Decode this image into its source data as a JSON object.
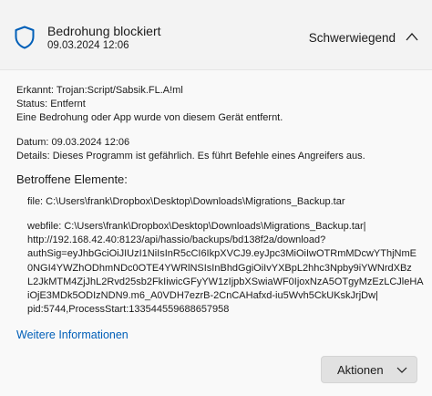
{
  "header": {
    "title": "Bedrohung blockiert",
    "timestamp": "09.03.2024 12:06",
    "severity": "Schwerwiegend",
    "icon": "shield-icon",
    "accent_color": "#005fb8"
  },
  "details": {
    "detected": "Erkannt:  Trojan:Script/Sabsik.FL.A!ml",
    "status": "Status:  Entfernt",
    "status_message": "Eine Bedrohung oder App wurde von diesem Gerät entfernt.",
    "date": "Datum:  09.03.2024 12:06",
    "description": "Details:  Dieses Programm ist gefährlich. Es führt Befehle eines Angreifers aus."
  },
  "affected": {
    "title": "Betroffene Elemente:",
    "file_line": "file: C:\\Users\\frank\\Dropbox\\Desktop\\Downloads\\Migrations_Backup.tar",
    "webfile_lines": [
      "webfile: C:\\Users\\frank\\Dropbox\\Desktop\\Downloads\\Migrations_Backup.tar|",
      "http://192.168.42.40:8123/api/hassio/backups/bd138f2a/download?",
      "authSig=eyJhbGciOiJIUzI1NiIsInR5cCI6IkpXVCJ9.eyJpc3MiOiIwOTRmMDcwYThjNmE",
      "0NGI4YWZhODhmNDc0OTE4YWRlNSIsInBhdGgiOiIvYXBpL2hhc3Npby9iYWNrdXBz",
      "L2JkMTM4ZjJhL2Rvd25sb2FkIiwicGFyYW1zIjpbXSwiaWF0IjoxNzA5OTgyMzEzLCJleHA",
      "iOjE3MDk5ODIzNDN9.m6_A0VDH7ezrB-2CnCAHafxd-iu5Wvh5CkUKskJrjDw|",
      "pid:5744,ProcessStart:133544559688657958"
    ]
  },
  "links": {
    "more_info": "Weitere Informationen"
  },
  "buttons": {
    "actions": "Aktionen"
  }
}
